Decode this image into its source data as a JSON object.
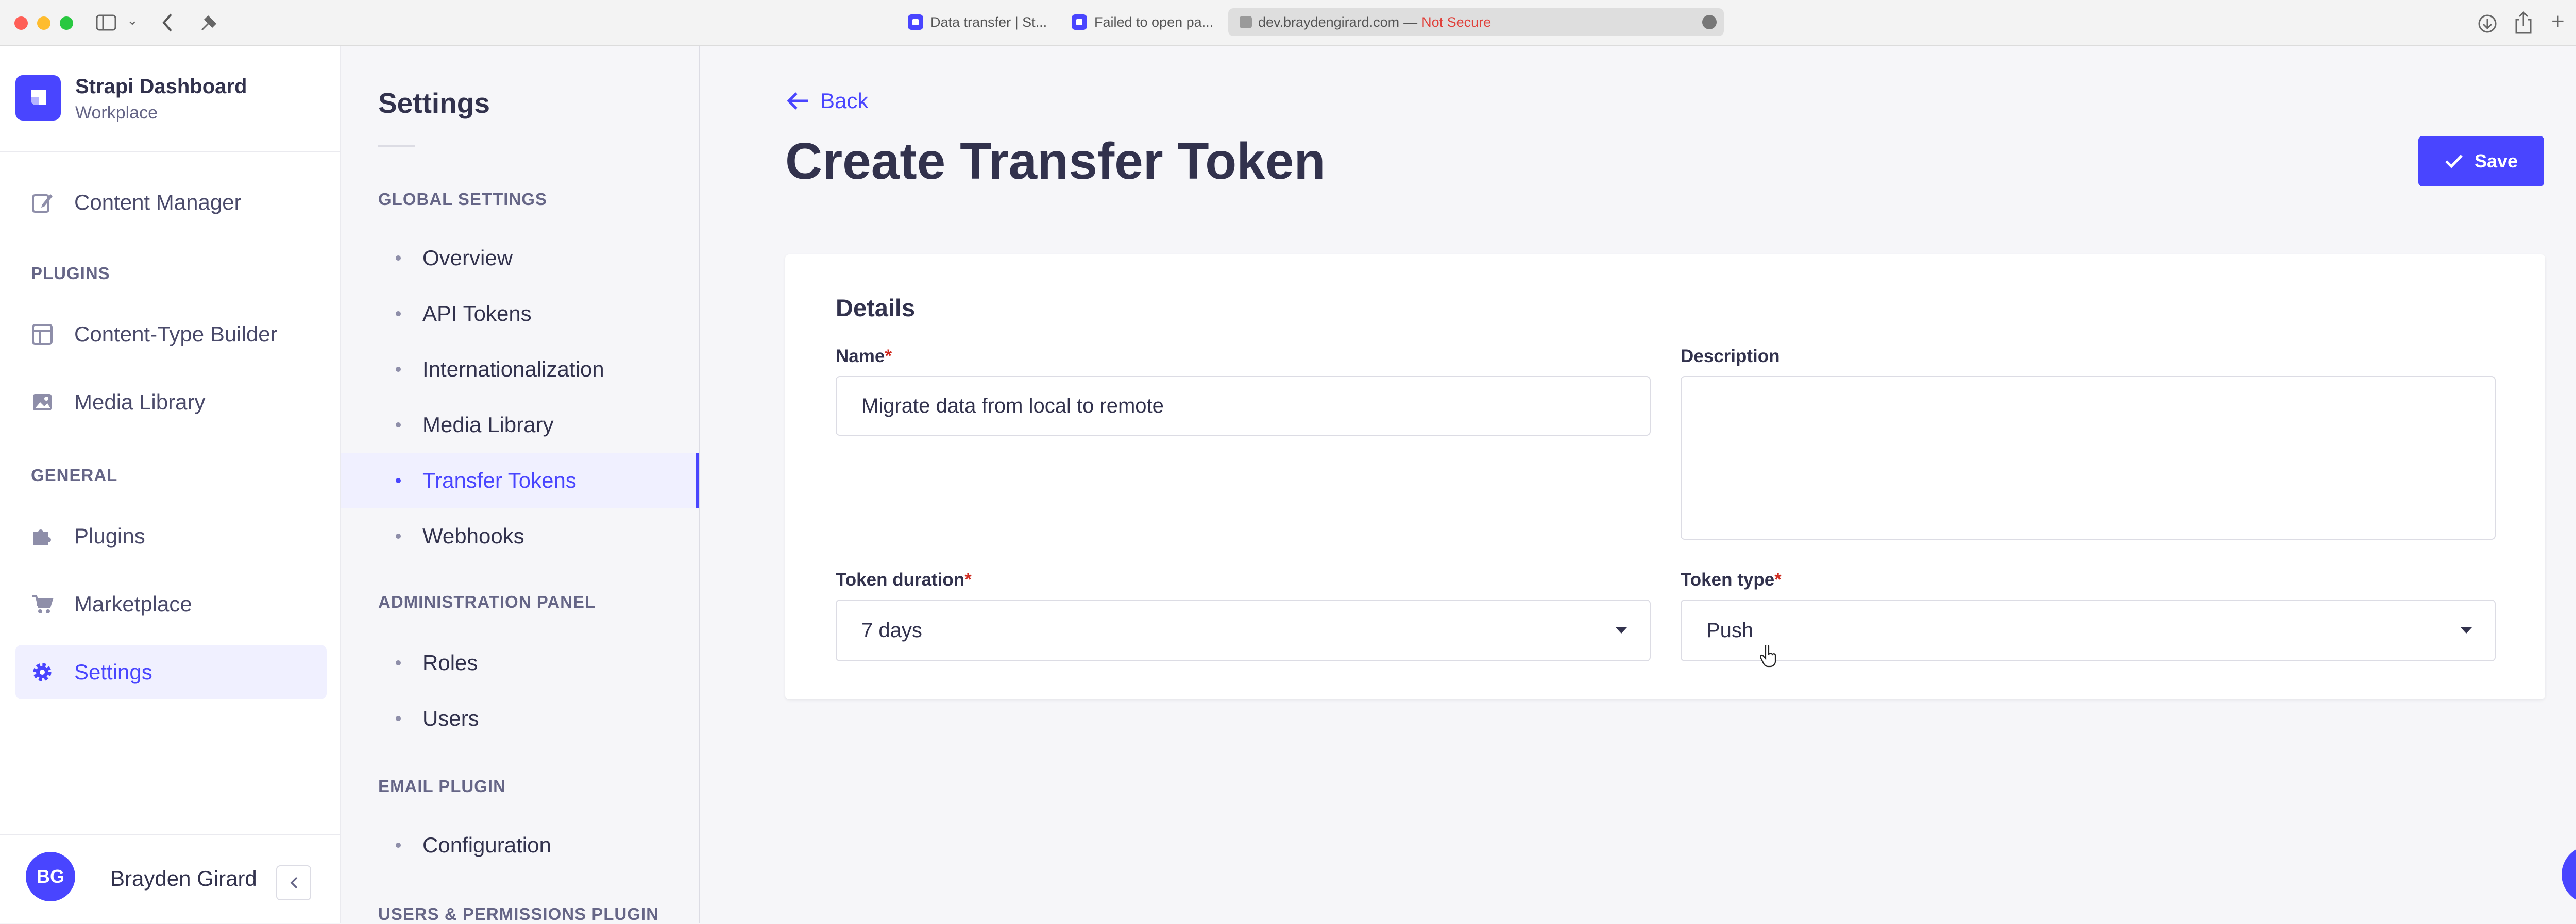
{
  "browser": {
    "tabs": [
      {
        "title": "Data transfer | St..."
      },
      {
        "title": "Failed to open pa..."
      }
    ],
    "address": {
      "domain": "dev.braydengirard.com",
      "separator": "—",
      "warning": "Not Secure"
    }
  },
  "app": {
    "name": "Strapi Dashboard",
    "workspace": "Workplace"
  },
  "main_nav": {
    "content_manager": "Content Manager",
    "plugins_heading": "PLUGINS",
    "content_type_builder": "Content-Type Builder",
    "media_library": "Media Library",
    "general_heading": "GENERAL",
    "plugins": "Plugins",
    "marketplace": "Marketplace",
    "settings": "Settings"
  },
  "user": {
    "initials": "BG",
    "name": "Brayden Girard"
  },
  "settings_nav": {
    "title": "Settings",
    "global_heading": "GLOBAL SETTINGS",
    "global_items": [
      "Overview",
      "API Tokens",
      "Internationalization",
      "Media Library",
      "Transfer Tokens",
      "Webhooks"
    ],
    "admin_heading": "ADMINISTRATION PANEL",
    "admin_items": [
      "Roles",
      "Users"
    ],
    "email_heading": "EMAIL PLUGIN",
    "email_items": [
      "Configuration"
    ],
    "users_perm_heading": "USERS & PERMISSIONS PLUGIN"
  },
  "page": {
    "back_label": "Back",
    "title": "Create Transfer Token",
    "save_label": "Save",
    "details_heading": "Details",
    "name_label": "Name",
    "name_value": "Migrate data from local to remote",
    "description_label": "Description",
    "description_value": "",
    "duration_label": "Token duration",
    "duration_value": "7 days",
    "type_label": "Token type",
    "type_value": "Push",
    "required_mark": "*"
  },
  "help_label": "?",
  "colors": {
    "accent": "#4945ff",
    "required": "#d02b20"
  }
}
